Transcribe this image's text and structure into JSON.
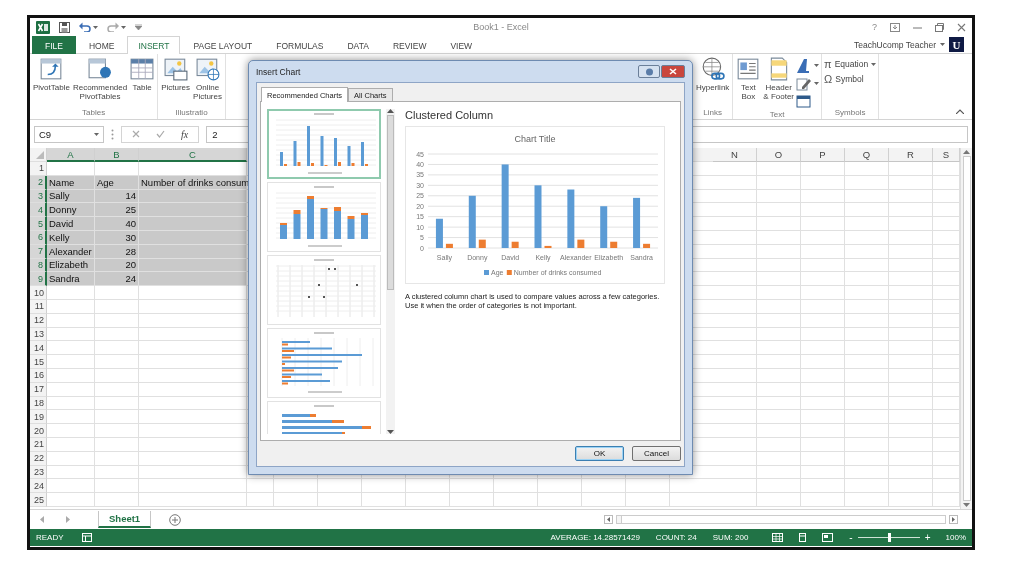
{
  "window": {
    "title": "Book1 - Excel",
    "help": "?"
  },
  "ribbon_tabs": [
    {
      "label": "FILE",
      "kind": "file",
      "selected": false
    },
    {
      "label": "HOME",
      "kind": "tab",
      "selected": false
    },
    {
      "label": "INSERT",
      "kind": "tab",
      "selected": true
    },
    {
      "label": "PAGE LAYOUT",
      "kind": "tab",
      "selected": false
    },
    {
      "label": "FORMULAS",
      "kind": "tab",
      "selected": false
    },
    {
      "label": "DATA",
      "kind": "tab",
      "selected": false
    },
    {
      "label": "REVIEW",
      "kind": "tab",
      "selected": false
    },
    {
      "label": "VIEW",
      "kind": "tab",
      "selected": false
    }
  ],
  "account": {
    "name": "TeachUcomp Teacher",
    "logo": "U"
  },
  "ribbon": {
    "left_groups": [
      {
        "label": "Tables",
        "commands": [
          {
            "kind": "pivot",
            "label": "PivotTable"
          },
          {
            "kind": "recpivot",
            "label": "Recommended\nPivotTables"
          },
          {
            "kind": "table",
            "label": "Table"
          }
        ]
      },
      {
        "label": "Illustratio",
        "commands": [
          {
            "kind": "pictures",
            "label": "Pictures"
          },
          {
            "kind": "online",
            "label": "Online\nPictures"
          }
        ]
      }
    ],
    "right_groups": [
      {
        "label": "Links",
        "commands": [
          {
            "kind": "hyperlink",
            "label": "Hyperlink"
          }
        ]
      },
      {
        "label": "Text",
        "commands": [
          {
            "kind": "textbox",
            "label": "Text\nBox"
          },
          {
            "kind": "header",
            "label": "Header\n& Footer"
          },
          {
            "kind": "stack",
            "items": [
              {
                "kind": "wordart",
                "dropdown": true
              },
              {
                "kind": "signature",
                "dropdown": true
              },
              {
                "kind": "object",
                "dropdown": false
              }
            ]
          }
        ]
      },
      {
        "label": "Symbols",
        "commands": [
          {
            "kind": "stack",
            "items": [
              {
                "kind": "glyph",
                "glyph": "π",
                "label": "Equation",
                "dropdown": true
              },
              {
                "kind": "glyph",
                "glyph": "Ω",
                "label": "Symbol",
                "dropdown": false
              }
            ]
          }
        ]
      }
    ]
  },
  "formula_bar": {
    "name_box": "C9",
    "function_button": "fx",
    "value": "2"
  },
  "spreadsheet": {
    "columns": [
      {
        "label": "A",
        "selected": true
      },
      {
        "label": "B",
        "selected": true
      },
      {
        "label": "C",
        "selected": true
      },
      {
        "label": "N",
        "selected": false
      },
      {
        "label": "O",
        "selected": false
      },
      {
        "label": "P",
        "selected": false
      },
      {
        "label": "Q",
        "selected": false
      },
      {
        "label": "R",
        "selected": false
      },
      {
        "label": "S",
        "selected": false
      }
    ],
    "rows": [
      {
        "number": "1",
        "selected": false
      },
      {
        "number": "2",
        "selected": true,
        "cells": [
          {
            "text": "Name",
            "kind": "text"
          },
          {
            "text": "Age",
            "kind": "text"
          },
          {
            "text": "Number of drinks consum",
            "kind": "text"
          }
        ]
      },
      {
        "number": "3",
        "selected": true,
        "cells": [
          {
            "text": "Sally",
            "kind": "text"
          },
          {
            "text": "14",
            "kind": "number"
          }
        ]
      },
      {
        "number": "4",
        "selected": true,
        "cells": [
          {
            "text": "Donny",
            "kind": "text"
          },
          {
            "text": "25",
            "kind": "number"
          }
        ]
      },
      {
        "number": "5",
        "selected": true,
        "cells": [
          {
            "text": "David",
            "kind": "text"
          },
          {
            "text": "40",
            "kind": "number"
          }
        ]
      },
      {
        "number": "6",
        "selected": true,
        "cells": [
          {
            "text": "Kelly",
            "kind": "text"
          },
          {
            "text": "30",
            "kind": "number"
          }
        ]
      },
      {
        "number": "7",
        "selected": true,
        "cells": [
          {
            "text": "Alexander",
            "kind": "text"
          },
          {
            "text": "28",
            "kind": "number"
          }
        ]
      },
      {
        "number": "8",
        "selected": true,
        "cells": [
          {
            "text": "Elizabeth",
            "kind": "text"
          },
          {
            "text": "20",
            "kind": "number"
          }
        ]
      },
      {
        "number": "9",
        "selected": true,
        "cells": [
          {
            "text": "Sandra",
            "kind": "text"
          },
          {
            "text": "24",
            "kind": "number"
          }
        ]
      },
      {
        "number": "10",
        "selected": false
      },
      {
        "number": "11",
        "selected": false
      },
      {
        "number": "12",
        "selected": false
      },
      {
        "number": "13",
        "selected": false
      },
      {
        "number": "14",
        "selected": false
      },
      {
        "number": "15",
        "selected": false
      },
      {
        "number": "16",
        "selected": false
      },
      {
        "number": "17",
        "selected": false
      },
      {
        "number": "18",
        "selected": false
      },
      {
        "number": "19",
        "selected": false
      },
      {
        "number": "20",
        "selected": false
      },
      {
        "number": "21",
        "selected": false
      },
      {
        "number": "22",
        "selected": false
      },
      {
        "number": "23",
        "selected": false
      },
      {
        "number": "24",
        "selected": false
      },
      {
        "number": "25",
        "selected": false
      }
    ]
  },
  "sheet_tabs": [
    {
      "label": "Sheet1",
      "selected": true
    }
  ],
  "status_bar": {
    "mode": "READY",
    "stats": [
      "AVERAGE: 14.28571429",
      "COUNT: 24",
      "SUM: 200"
    ],
    "zoom_out": "-",
    "zoom": {
      "level": 0.5
    },
    "zoom_in": "+",
    "zoom_label": "100%"
  },
  "dialog": {
    "title": "Insert Chart",
    "tabs": [
      {
        "label": "Recommended Charts",
        "selected": true
      },
      {
        "label": "All Charts",
        "selected": false
      }
    ],
    "thumbnails": [
      {
        "kind": "clustered",
        "selected": true
      },
      {
        "kind": "stacked",
        "selected": false
      },
      {
        "kind": "scatter",
        "selected": false
      },
      {
        "kind": "bar",
        "selected": false
      },
      {
        "kind": "stacked-bar",
        "selected": false
      }
    ],
    "preview": {
      "heading": "Clustered Column",
      "chart_data": {
        "type": "bar",
        "title": "Chart Title",
        "categories": [
          "Sally",
          "Donny",
          "David",
          "Kelly",
          "Alexander",
          "Elizabeth",
          "Sandra"
        ],
        "series": [
          {
            "name": "Age",
            "color": "#5b9bd5",
            "values": [
              14,
              25,
              40,
              30,
              28,
              20,
              24
            ]
          },
          {
            "name": "Number of drinks consumed",
            "color": "#ed7d31",
            "values": [
              2,
              4,
              3,
              1,
              4,
              3,
              2
            ]
          }
        ],
        "ylim": [
          0,
          45
        ],
        "yticks": [
          0,
          5,
          10,
          15,
          20,
          25,
          30,
          35,
          40,
          45
        ],
        "grid": true,
        "legend": "bottom"
      },
      "description": "A clustered column chart is used to compare values across a few categories. Use it when the order of categories is not important."
    },
    "buttons": [
      {
        "label": "OK",
        "default": true
      },
      {
        "label": "Cancel",
        "default": false
      }
    ]
  }
}
